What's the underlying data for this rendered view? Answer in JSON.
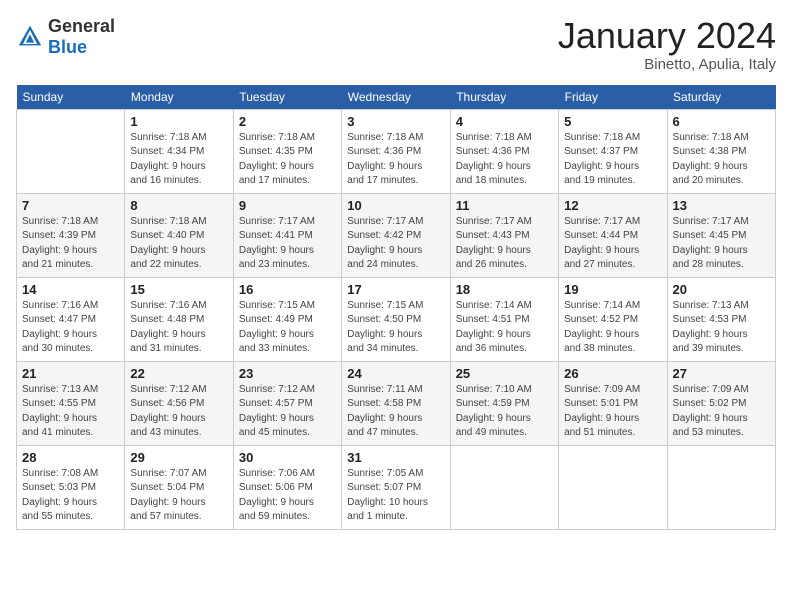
{
  "header": {
    "logo_general": "General",
    "logo_blue": "Blue",
    "month_title": "January 2024",
    "subtitle": "Binetto, Apulia, Italy"
  },
  "weekdays": [
    "Sunday",
    "Monday",
    "Tuesday",
    "Wednesday",
    "Thursday",
    "Friday",
    "Saturday"
  ],
  "weeks": [
    [
      {
        "day": "",
        "info": ""
      },
      {
        "day": "1",
        "info": "Sunrise: 7:18 AM\nSunset: 4:34 PM\nDaylight: 9 hours\nand 16 minutes."
      },
      {
        "day": "2",
        "info": "Sunrise: 7:18 AM\nSunset: 4:35 PM\nDaylight: 9 hours\nand 17 minutes."
      },
      {
        "day": "3",
        "info": "Sunrise: 7:18 AM\nSunset: 4:36 PM\nDaylight: 9 hours\nand 17 minutes."
      },
      {
        "day": "4",
        "info": "Sunrise: 7:18 AM\nSunset: 4:36 PM\nDaylight: 9 hours\nand 18 minutes."
      },
      {
        "day": "5",
        "info": "Sunrise: 7:18 AM\nSunset: 4:37 PM\nDaylight: 9 hours\nand 19 minutes."
      },
      {
        "day": "6",
        "info": "Sunrise: 7:18 AM\nSunset: 4:38 PM\nDaylight: 9 hours\nand 20 minutes."
      }
    ],
    [
      {
        "day": "7",
        "info": ""
      },
      {
        "day": "8",
        "info": "Sunrise: 7:18 AM\nSunset: 4:40 PM\nDaylight: 9 hours\nand 22 minutes."
      },
      {
        "day": "9",
        "info": "Sunrise: 7:17 AM\nSunset: 4:41 PM\nDaylight: 9 hours\nand 23 minutes."
      },
      {
        "day": "10",
        "info": "Sunrise: 7:17 AM\nSunset: 4:42 PM\nDaylight: 9 hours\nand 24 minutes."
      },
      {
        "day": "11",
        "info": "Sunrise: 7:17 AM\nSunset: 4:43 PM\nDaylight: 9 hours\nand 26 minutes."
      },
      {
        "day": "12",
        "info": "Sunrise: 7:17 AM\nSunset: 4:44 PM\nDaylight: 9 hours\nand 27 minutes."
      },
      {
        "day": "13",
        "info": "Sunrise: 7:17 AM\nSunset: 4:45 PM\nDaylight: 9 hours\nand 28 minutes."
      }
    ],
    [
      {
        "day": "14",
        "info": ""
      },
      {
        "day": "15",
        "info": "Sunrise: 7:16 AM\nSunset: 4:48 PM\nDaylight: 9 hours\nand 31 minutes."
      },
      {
        "day": "16",
        "info": "Sunrise: 7:15 AM\nSunset: 4:49 PM\nDaylight: 9 hours\nand 33 minutes."
      },
      {
        "day": "17",
        "info": "Sunrise: 7:15 AM\nSunset: 4:50 PM\nDaylight: 9 hours\nand 34 minutes."
      },
      {
        "day": "18",
        "info": "Sunrise: 7:14 AM\nSunset: 4:51 PM\nDaylight: 9 hours\nand 36 minutes."
      },
      {
        "day": "19",
        "info": "Sunrise: 7:14 AM\nSunset: 4:52 PM\nDaylight: 9 hours\nand 38 minutes."
      },
      {
        "day": "20",
        "info": "Sunrise: 7:13 AM\nSunset: 4:53 PM\nDaylight: 9 hours\nand 39 minutes."
      }
    ],
    [
      {
        "day": "21",
        "info": ""
      },
      {
        "day": "22",
        "info": "Sunrise: 7:12 AM\nSunset: 4:56 PM\nDaylight: 9 hours\nand 43 minutes."
      },
      {
        "day": "23",
        "info": "Sunrise: 7:12 AM\nSunset: 4:57 PM\nDaylight: 9 hours\nand 45 minutes."
      },
      {
        "day": "24",
        "info": "Sunrise: 7:11 AM\nSunset: 4:58 PM\nDaylight: 9 hours\nand 47 minutes."
      },
      {
        "day": "25",
        "info": "Sunrise: 7:10 AM\nSunset: 4:59 PM\nDaylight: 9 hours\nand 49 minutes."
      },
      {
        "day": "26",
        "info": "Sunrise: 7:09 AM\nSunset: 5:01 PM\nDaylight: 9 hours\nand 51 minutes."
      },
      {
        "day": "27",
        "info": "Sunrise: 7:09 AM\nSunset: 5:02 PM\nDaylight: 9 hours\nand 53 minutes."
      }
    ],
    [
      {
        "day": "28",
        "info": "Sunrise: 7:08 AM\nSunset: 5:03 PM\nDaylight: 9 hours\nand 55 minutes."
      },
      {
        "day": "29",
        "info": "Sunrise: 7:07 AM\nSunset: 5:04 PM\nDaylight: 9 hours\nand 57 minutes."
      },
      {
        "day": "30",
        "info": "Sunrise: 7:06 AM\nSunset: 5:06 PM\nDaylight: 9 hours\nand 59 minutes."
      },
      {
        "day": "31",
        "info": "Sunrise: 7:05 AM\nSunset: 5:07 PM\nDaylight: 10 hours\nand 1 minute."
      },
      {
        "day": "",
        "info": ""
      },
      {
        "day": "",
        "info": ""
      },
      {
        "day": "",
        "info": ""
      }
    ]
  ],
  "week7_sunday_info": "Sunrise: 7:18 AM\nSunset: 4:39 PM\nDaylight: 9 hours\nand 21 minutes.",
  "week14_sunday_info": "Sunrise: 7:16 AM\nSunset: 4:47 PM\nDaylight: 9 hours\nand 30 minutes.",
  "week21_sunday_info": "Sunrise: 7:13 AM\nSunset: 4:55 PM\nDaylight: 9 hours\nand 41 minutes."
}
